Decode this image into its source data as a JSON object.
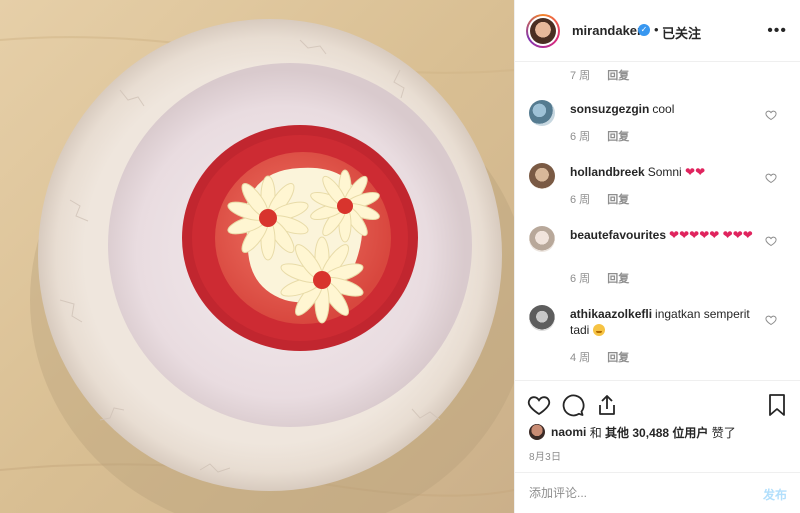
{
  "header": {
    "username": "mirandakerr",
    "separator": "•",
    "follow_status": "已关注",
    "more_icon": "more-horizontal-icon"
  },
  "top_meta": {
    "time": "7 周",
    "reply": "回复"
  },
  "comments": [
    {
      "username": "sonsuzgezgin",
      "text": "cool",
      "time": "6 周",
      "reply": "回复",
      "emoji_hearts": 0,
      "face_emoji": false
    },
    {
      "username": "hollandbreek",
      "text": "Somni",
      "time": "6 周",
      "reply": "回复",
      "emoji_hearts": 2,
      "face_emoji": false
    },
    {
      "username": "beautefavourites",
      "text": "",
      "time": "6 周",
      "reply": "回复",
      "emoji_hearts": 8,
      "face_emoji": false
    },
    {
      "username": "athikaazolkefli",
      "text": "ingatkan semperit tadi",
      "time": "4 周",
      "reply": "回复",
      "emoji_hearts": 0,
      "face_emoji": true
    }
  ],
  "likes": {
    "liker": "naomi",
    "and": "和",
    "others": "其他 30,488 位用户",
    "liked": "赞了"
  },
  "date": "8月3日",
  "add_comment": {
    "placeholder": "添加评论...",
    "post_label": "发布"
  },
  "colors": {
    "link_blue": "#3897f0",
    "disabled_blue": "#b2dffc",
    "heart_red": "#e0245e",
    "meta_gray": "#8e8e8e"
  }
}
